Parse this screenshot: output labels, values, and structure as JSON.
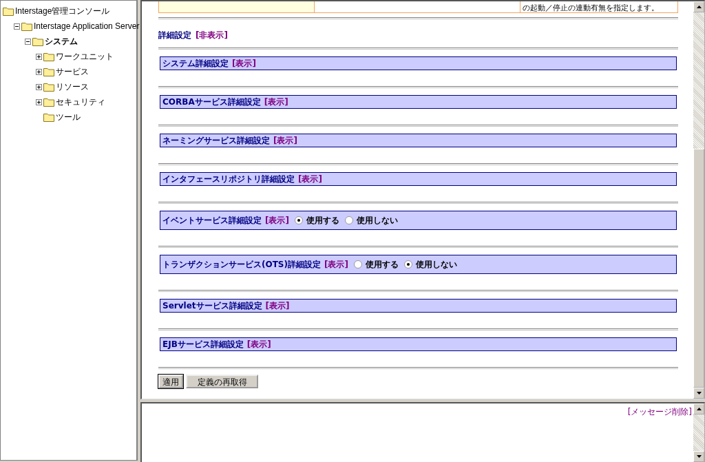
{
  "tree": [
    {
      "label": "Interstage管理コンソール",
      "selected": false,
      "children": [
        {
          "label": "Interstage Application Server",
          "selected": false,
          "expanded": true,
          "children": [
            {
              "label": "システム",
              "selected": true,
              "expanded": true,
              "children": [
                {
                  "label": "ワークユニット",
                  "selected": false,
                  "expanded": false
                },
                {
                  "label": "サービス",
                  "selected": false,
                  "expanded": false
                },
                {
                  "label": "リソース",
                  "selected": false,
                  "expanded": false
                },
                {
                  "label": "セキュリティ",
                  "selected": false,
                  "expanded": false
                },
                {
                  "label": "ツール",
                  "selected": false
                }
              ]
            }
          ]
        }
      ]
    }
  ],
  "top_row": {
    "column_3": "の起動／停止の連動有無を指定します。"
  },
  "details": {
    "title": "詳細設定",
    "link": "[非表示]"
  },
  "sections": [
    {
      "kind": "plain",
      "title": "システム詳細設定",
      "link": "[表示]"
    },
    {
      "kind": "plain",
      "title": "CORBAサービス詳細設定",
      "link": "[表示]"
    },
    {
      "kind": "plain",
      "title": "ネーミングサービス詳細設定",
      "link": "[表示]"
    },
    {
      "kind": "plain",
      "title": "インタフェースリポジトリ詳細設定",
      "link": "[表示]"
    },
    {
      "kind": "radio",
      "title": "イベントサービス詳細設定",
      "link": "[表示]",
      "options": [
        {
          "label": "使用する",
          "selected": true
        },
        {
          "label": "使用しない",
          "selected": false
        }
      ]
    },
    {
      "kind": "radio",
      "title": "トランザクションサービス(OTS)詳細設定",
      "link": "[表示]",
      "options": [
        {
          "label": "使用する",
          "selected": false
        },
        {
          "label": "使用しない",
          "selected": true
        }
      ]
    },
    {
      "kind": "plain",
      "title": "Servletサービス詳細設定",
      "link": "[表示]"
    },
    {
      "kind": "plain",
      "title": "EJBサービス詳細設定",
      "link": "[表示]"
    }
  ],
  "buttons": [
    "適用",
    "定義の再取得"
  ],
  "message_pane": {
    "link": "[メッセージ削除]"
  }
}
